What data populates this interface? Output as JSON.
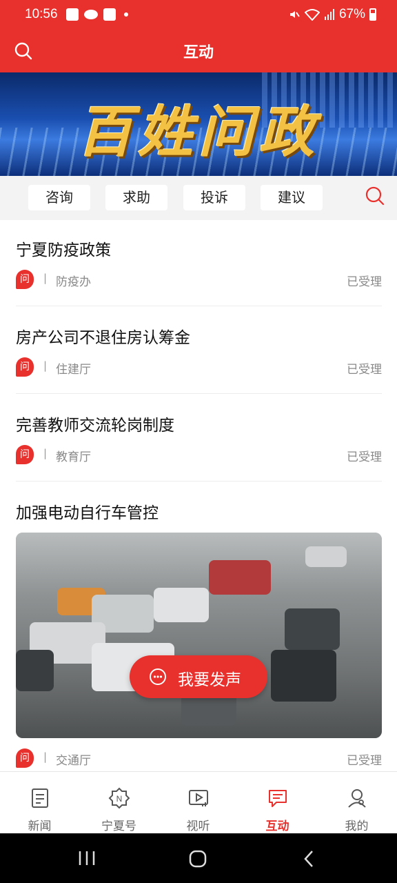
{
  "status_bar": {
    "time": "10:56",
    "battery": "67%"
  },
  "header": {
    "title": "互动"
  },
  "banner": {
    "text": "百姓问政"
  },
  "tabs": [
    {
      "label": "咨询"
    },
    {
      "label": "求助"
    },
    {
      "label": "投诉"
    },
    {
      "label": "建议"
    }
  ],
  "items": [
    {
      "title": "宁夏防疫政策",
      "badge": "问",
      "separator": "|",
      "dept": "防疫办",
      "status": "已受理"
    },
    {
      "title": "房产公司不退住房认筹金",
      "badge": "问",
      "separator": "|",
      "dept": "住建厅",
      "status": "已受理"
    },
    {
      "title": "完善教师交流轮岗制度",
      "badge": "问",
      "separator": "|",
      "dept": "教育厅",
      "status": "已受理"
    },
    {
      "title": "加强电动自行车管控",
      "badge": "问",
      "separator": "|",
      "dept": "交通厅",
      "status": "已受理"
    }
  ],
  "fab": {
    "label": "我要发声"
  },
  "bottom_nav": [
    {
      "label": "新闻",
      "icon": "news-icon"
    },
    {
      "label": "宁夏号",
      "icon": "ningxia-hao-icon"
    },
    {
      "label": "视听",
      "icon": "video-icon"
    },
    {
      "label": "互动",
      "icon": "chat-icon",
      "active": true
    },
    {
      "label": "我的",
      "icon": "profile-icon"
    }
  ],
  "colors": {
    "accent": "#e8302c"
  }
}
